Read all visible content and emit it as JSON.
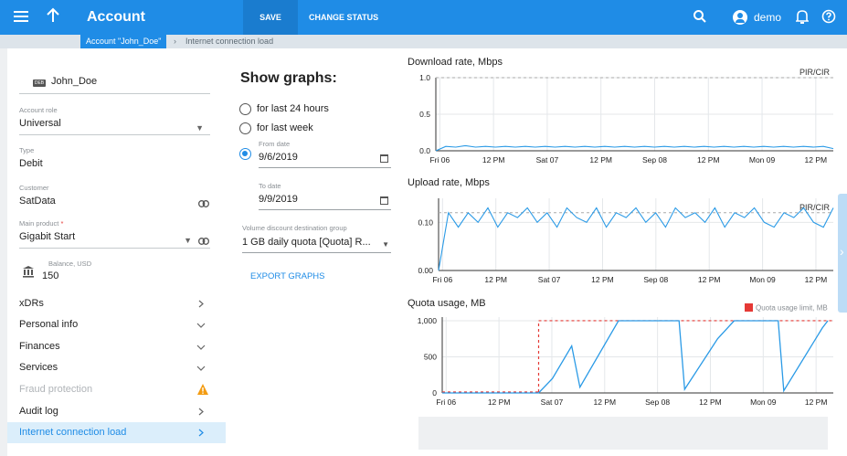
{
  "header": {
    "title": "Account",
    "save": "SAVE",
    "change_status": "CHANGE STATUS",
    "user": "demo"
  },
  "breadcrumb": {
    "account": "Account \"John_Doe\"",
    "current": "Internet connection load"
  },
  "account": {
    "badge": "DEB",
    "name": "John_Doe",
    "role_label": "Account role",
    "role": "Universal",
    "type_label": "Type",
    "type": "Debit",
    "customer_label": "Customer",
    "customer": "SatData",
    "product_label": "Main product",
    "product_required": "*",
    "product": "Gigabit Start",
    "balance_label": "Balance, USD",
    "balance": "150"
  },
  "nav": [
    {
      "label": "xDRs",
      "chevron": "right"
    },
    {
      "label": "Personal info",
      "chevron": "down"
    },
    {
      "label": "Finances",
      "chevron": "down"
    },
    {
      "label": "Services",
      "chevron": "down"
    },
    {
      "label": "Fraud protection",
      "chevron": "warning"
    },
    {
      "label": "Audit log",
      "chevron": "right"
    },
    {
      "label": "Internet connection load",
      "chevron": "right"
    }
  ],
  "graphs_panel": {
    "title": "Show graphs:",
    "opt_24h": "for last 24 hours",
    "opt_week": "for last week",
    "from_label": "From date",
    "from": "9/6/2019",
    "to_label": "To date",
    "to": "9/9/2019",
    "group_label": "Volume discount destination group",
    "group": "1 GB daily quota [Quota] R...",
    "export": "EXPORT GRAPHS"
  },
  "chart_data": [
    {
      "type": "line",
      "title": "Download rate, Mbps",
      "x_ticks": [
        "Fri 06",
        "12 PM",
        "Sat 07",
        "12 PM",
        "Sep 08",
        "12 PM",
        "Mon 09",
        "12 PM"
      ],
      "y_ticks": [
        "1.0",
        "0.5",
        "0.0"
      ],
      "ylim": [
        0,
        1
      ],
      "reference_label": "PIR/CIR",
      "reference_value": 1.0,
      "series": [
        {
          "values": [
            0.0,
            0.06,
            0.05,
            0.07,
            0.05,
            0.06,
            0.05,
            0.06,
            0.05,
            0.06,
            0.05,
            0.06,
            0.05,
            0.06,
            0.05,
            0.06,
            0.05,
            0.06,
            0.05,
            0.06,
            0.05,
            0.06,
            0.05,
            0.06,
            0.05,
            0.06,
            0.05,
            0.06,
            0.05,
            0.06,
            0.05,
            0.06,
            0.05,
            0.06,
            0.05,
            0.06,
            0.05,
            0.06,
            0.05,
            0.06,
            0.03
          ]
        }
      ],
      "color": "#2a9ae6"
    },
    {
      "type": "line",
      "title": "Upload rate, Mbps",
      "x_ticks": [
        "Fri 06",
        "12 PM",
        "Sat 07",
        "12 PM",
        "Sep 08",
        "12 PM",
        "Mon 09",
        "12 PM"
      ],
      "y_ticks": [
        "0.10",
        "0.00"
      ],
      "ylim": [
        0,
        0.15
      ],
      "reference_label": "PIR/CIR",
      "reference_value": 0.12,
      "series": [
        {
          "values": [
            0.0,
            0.12,
            0.09,
            0.12,
            0.1,
            0.13,
            0.09,
            0.12,
            0.11,
            0.13,
            0.1,
            0.12,
            0.09,
            0.13,
            0.11,
            0.1,
            0.13,
            0.09,
            0.12,
            0.11,
            0.13,
            0.1,
            0.12,
            0.09,
            0.13,
            0.11,
            0.12,
            0.1,
            0.13,
            0.09,
            0.12,
            0.11,
            0.13,
            0.1,
            0.09,
            0.12,
            0.11,
            0.13,
            0.1,
            0.09,
            0.13
          ]
        }
      ],
      "color": "#2a9ae6"
    },
    {
      "type": "line",
      "title": "Quota usage, MB",
      "legend": "Quota usage limit, MB",
      "legend_color": "#e53935",
      "x_ticks": [
        "Fri 06",
        "12 PM",
        "Sat 07",
        "12 PM",
        "Sep 08",
        "12 PM",
        "Mon 09",
        "12 PM"
      ],
      "y_ticks": [
        "1,000",
        "500",
        "0"
      ],
      "ylim": [
        0,
        1050
      ],
      "x": [
        0,
        1.75,
        2.0,
        2.35,
        2.5,
        3.2,
        3.4,
        4.3,
        4.4,
        5.0,
        5.3,
        6.1,
        6.2,
        6.9,
        7.0
      ],
      "values": [
        0,
        0,
        200,
        650,
        80,
        1000,
        1000,
        1000,
        50,
        750,
        1000,
        1000,
        30,
        900,
        1000
      ],
      "limit": {
        "x_start": 1.75,
        "value": 1000
      },
      "color": "#2a9ae6"
    }
  ]
}
